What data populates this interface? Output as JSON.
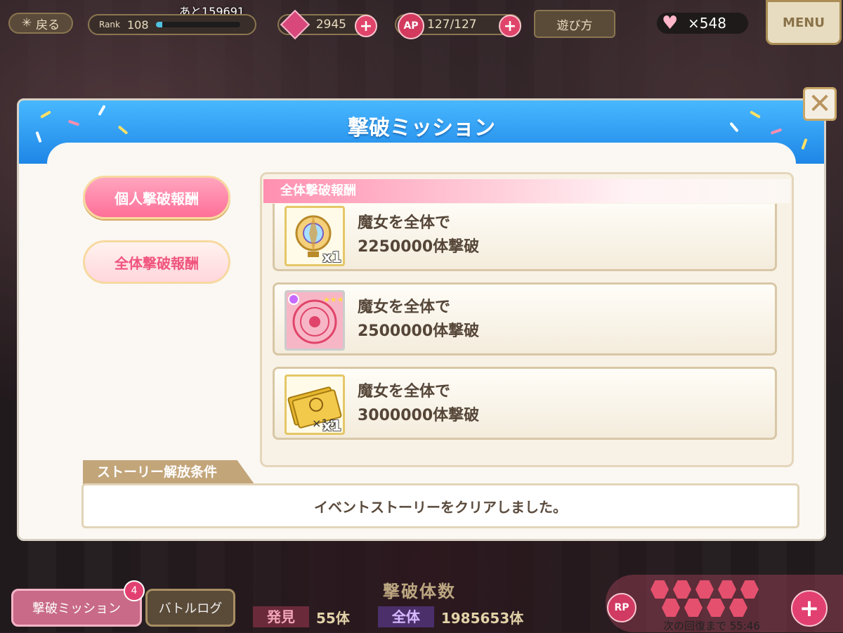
{
  "topbar": {
    "back_label": "戻る",
    "rank_label": "Rank",
    "rank_value": "108",
    "rank_remaining": "あと159691",
    "rank_progress": 0.08,
    "gems": "2945",
    "ap_label": "AP",
    "ap_value": "127/127",
    "howto_label": "遊び方",
    "hearts": "×548",
    "menu_label": "MENU"
  },
  "modal": {
    "title": "撃破ミッション",
    "tabs": [
      {
        "label": "個人撃破報酬"
      },
      {
        "label": "全体撃破報酬"
      }
    ],
    "section_header": "全体撃破報酬",
    "rewards": [
      {
        "line1": "魔女を全体で",
        "line2": "2250000体撃破",
        "qty": "x1",
        "icon": "compass-icon"
      },
      {
        "line1": "魔女を全体で",
        "line2": "2500000体撃破",
        "qty": "",
        "icon": "magic-circle-icon"
      },
      {
        "line1": "魔女を全体で",
        "line2": "3000000体撃破",
        "qty": "x1",
        "sub_qty": "×10",
        "icon": "ticket-icon"
      }
    ],
    "story_tab": "ストーリー解放条件",
    "story_text": "イベントストーリーをクリアしました。"
  },
  "bottom": {
    "mission_btn": "撃破ミッション",
    "mission_badge": "4",
    "log_btn": "バトルログ",
    "defeat_title": "撃破体数",
    "found_label": "発見",
    "found_value": "55体",
    "all_label": "全体",
    "all_value": "1985653体",
    "rp_label": "RP",
    "recover_text": "次の回復まで 55:46"
  }
}
